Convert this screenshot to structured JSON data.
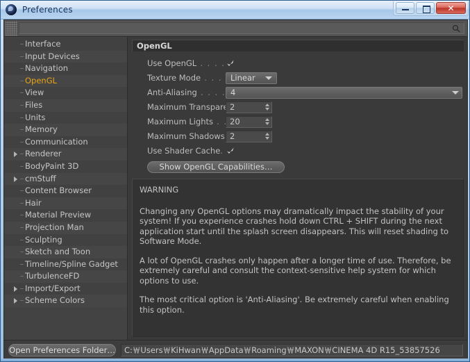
{
  "window": {
    "title": "Preferences",
    "icon": "c4d-app-icon",
    "buttons": {
      "minimize": "minimize",
      "maximize": "maximize",
      "close": "✕"
    }
  },
  "toolbar": {
    "grip": "drag-grip",
    "search_icon": "search-icon",
    "search_value": ""
  },
  "sidebar": {
    "items": [
      {
        "label": "Interface",
        "expandable": false,
        "selected": false
      },
      {
        "label": "Input Devices",
        "expandable": false,
        "selected": false
      },
      {
        "label": "Navigation",
        "expandable": false,
        "selected": false
      },
      {
        "label": "OpenGL",
        "expandable": false,
        "selected": true
      },
      {
        "label": "View",
        "expandable": false,
        "selected": false
      },
      {
        "label": "Files",
        "expandable": false,
        "selected": false
      },
      {
        "label": "Units",
        "expandable": false,
        "selected": false
      },
      {
        "label": "Memory",
        "expandable": false,
        "selected": false
      },
      {
        "label": "Communication",
        "expandable": false,
        "selected": false
      },
      {
        "label": "Renderer",
        "expandable": true,
        "selected": false
      },
      {
        "label": "BodyPaint 3D",
        "expandable": false,
        "selected": false
      },
      {
        "label": "cmStuff",
        "expandable": true,
        "selected": false
      },
      {
        "label": "Content Browser",
        "expandable": false,
        "selected": false
      },
      {
        "label": "Hair",
        "expandable": false,
        "selected": false
      },
      {
        "label": "Material Preview",
        "expandable": false,
        "selected": false
      },
      {
        "label": "Projection Man",
        "expandable": false,
        "selected": false
      },
      {
        "label": "Sculpting",
        "expandable": false,
        "selected": false
      },
      {
        "label": "Sketch and Toon",
        "expandable": false,
        "selected": false
      },
      {
        "label": "Timeline/Spline Gadget",
        "expandable": false,
        "selected": false
      },
      {
        "label": "TurbulenceFD",
        "expandable": false,
        "selected": false
      },
      {
        "label": "Import/Export",
        "expandable": true,
        "selected": false
      },
      {
        "label": "Scheme Colors",
        "expandable": true,
        "selected": false
      }
    ]
  },
  "panel": {
    "group_title": "OpenGL",
    "rows": {
      "use_opengl": {
        "label": "Use OpenGL",
        "leader": " . . . . . . . . .",
        "checked": true
      },
      "texture_mode": {
        "label": "Texture Mode",
        "leader": " . . . . . . . .",
        "value": "Linear"
      },
      "anti_aliasing": {
        "label": "Anti-Aliasing",
        "leader": " . . . . . . . . .",
        "value": "4"
      },
      "maximum_transparency": {
        "label": "Maximum Transparency",
        "leader": "",
        "value": "2"
      },
      "maximum_lights": {
        "label": "Maximum Lights",
        "leader": " . . . . . . .",
        "value": "20"
      },
      "maximum_shadows": {
        "label": "Maximum Shadows",
        "leader": ". . . .",
        "value": "2"
      },
      "use_shader_cache": {
        "label": "Use Shader Cache",
        "leader": ". . . . .",
        "checked": true
      }
    },
    "capabilities_button": "Show OpenGL Capabilities…",
    "warning": {
      "heading": "WARNING",
      "paragraph1": "Changing any OpenGL options may dramatically impact the stability of your system! If you experience crashes hold down CTRL + SHIFT during the next application start until the splash screen disappears. This will reset shading to Software Mode.",
      "paragraph2": "A lot of OpenGL crashes only happen after a longer time of use. Therefore, be extremely careful and consult the context-sensitive help system for which options to use.",
      "paragraph3": "The most critical option is 'Anti-Aliasing'. Be extremely careful when enabling this option."
    }
  },
  "bottom": {
    "open_folder_button": "Open Preferences Folder…",
    "path_value": "C:￦Users￦KiHwan￦AppData￦Roaming￦MAXON￦CINEMA 4D R15_53857526"
  },
  "colors": {
    "accent_selected": "#e8a317",
    "panel_bg": "#3a3a3a",
    "sidebar_bg": "#434343",
    "warning_bg": "#333333",
    "titlebar_blue": "#b9d2ec"
  }
}
